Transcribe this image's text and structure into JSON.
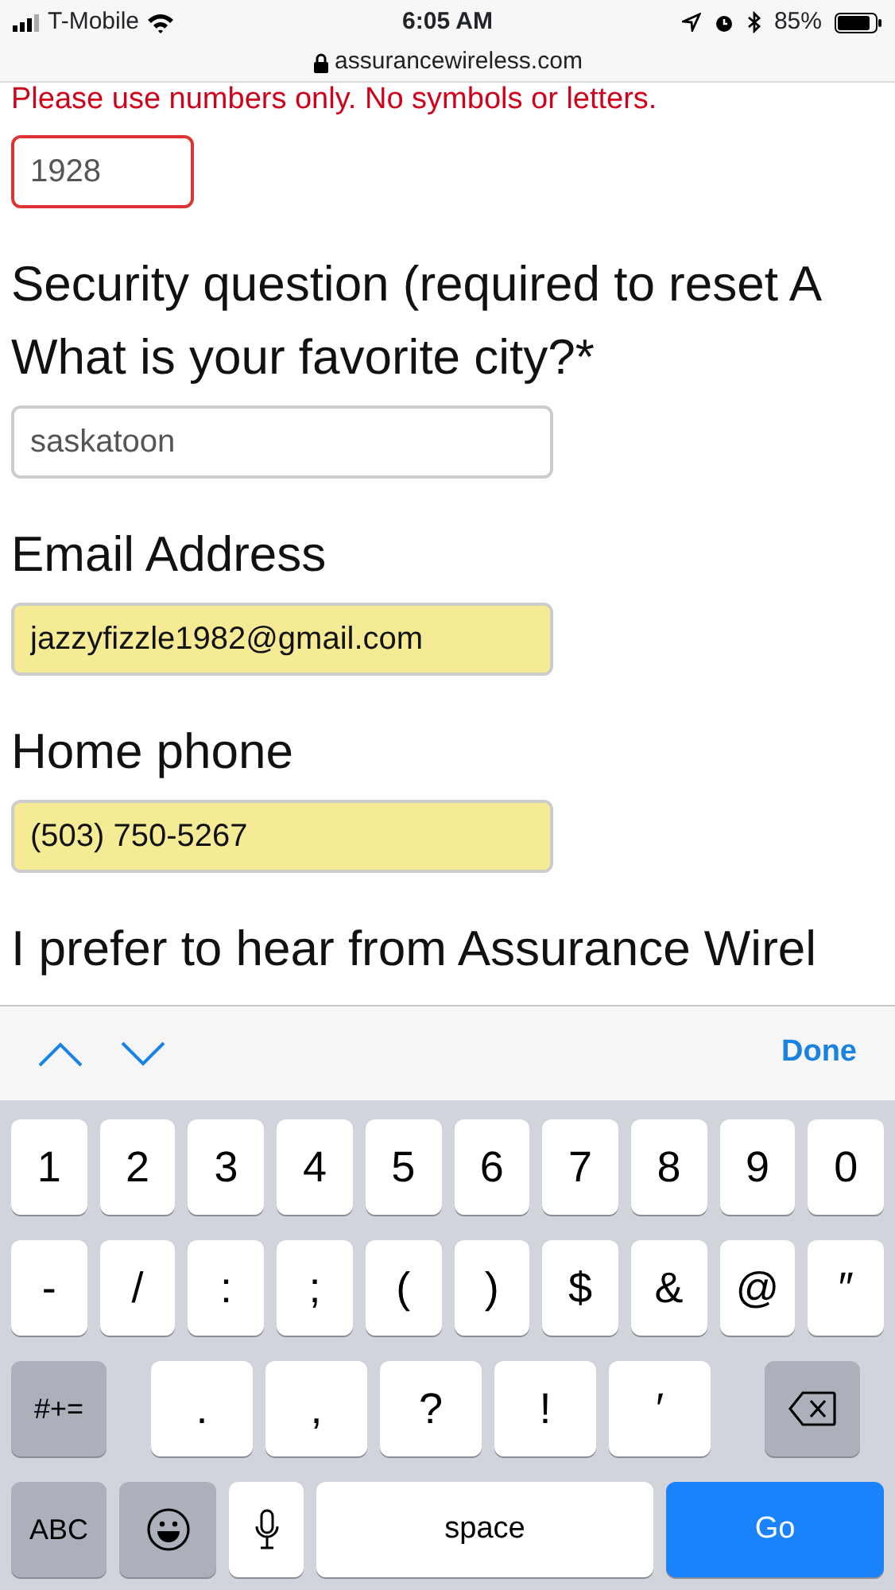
{
  "status_bar": {
    "carrier": "T-Mobile",
    "time": "6:05 AM",
    "battery": "85%",
    "url": "assurancewireless.com"
  },
  "form": {
    "error_message": "Please use numbers only. No symbols or letters.",
    "items": [
      {
        "kind": "field",
        "value": "1928",
        "invalid": true,
        "autofilled": false
      },
      {
        "kind": "label",
        "text": "Security question (required to reset A"
      },
      {
        "kind": "label",
        "text": "What is your favorite city?*"
      },
      {
        "kind": "field",
        "value": "saskatoon",
        "invalid": false,
        "autofilled": false
      },
      {
        "kind": "label",
        "text": "Email Address"
      },
      {
        "kind": "field",
        "value": "jazzyfizzle1982@gmail.com",
        "invalid": false,
        "autofilled": true
      },
      {
        "kind": "label",
        "text": "Home phone"
      },
      {
        "kind": "field",
        "value": "(503) 750-5267",
        "invalid": false,
        "autofilled": true
      },
      {
        "kind": "label",
        "text": "I prefer to hear from Assurance Wirel"
      }
    ]
  },
  "toolbar": {
    "done": "Done"
  },
  "keyboard": {
    "rows": [
      {
        "keys": [
          {
            "kind": "char",
            "label": "1"
          },
          {
            "kind": "char",
            "label": "2"
          },
          {
            "kind": "char",
            "label": "3"
          },
          {
            "kind": "char",
            "label": "4"
          },
          {
            "kind": "char",
            "label": "5"
          },
          {
            "kind": "char",
            "label": "6"
          },
          {
            "kind": "char",
            "label": "7"
          },
          {
            "kind": "char",
            "label": "8"
          },
          {
            "kind": "char",
            "label": "9"
          },
          {
            "kind": "char",
            "label": "0"
          }
        ]
      },
      {
        "keys": [
          {
            "kind": "char",
            "label": "-"
          },
          {
            "kind": "char",
            "label": "/"
          },
          {
            "kind": "char",
            "label": ":"
          },
          {
            "kind": "char",
            "label": ";"
          },
          {
            "kind": "char",
            "label": "("
          },
          {
            "kind": "char",
            "label": ")"
          },
          {
            "kind": "char",
            "label": "$"
          },
          {
            "kind": "char",
            "label": "&"
          },
          {
            "kind": "char",
            "label": "@"
          },
          {
            "kind": "char",
            "label": "″"
          }
        ]
      },
      {
        "keys": [
          {
            "kind": "function",
            "label": "#+="
          },
          {
            "kind": "char",
            "label": "."
          },
          {
            "kind": "char",
            "label": ","
          },
          {
            "kind": "char",
            "label": "?"
          },
          {
            "kind": "char",
            "label": "!"
          },
          {
            "kind": "char",
            "label": "′"
          },
          {
            "kind": "backspace"
          }
        ]
      },
      {
        "keys": [
          {
            "kind": "function",
            "label": "ABC"
          },
          {
            "kind": "emoji"
          },
          {
            "kind": "mic"
          },
          {
            "kind": "space",
            "label": "space"
          },
          {
            "kind": "go",
            "label": "Go"
          }
        ]
      }
    ]
  }
}
